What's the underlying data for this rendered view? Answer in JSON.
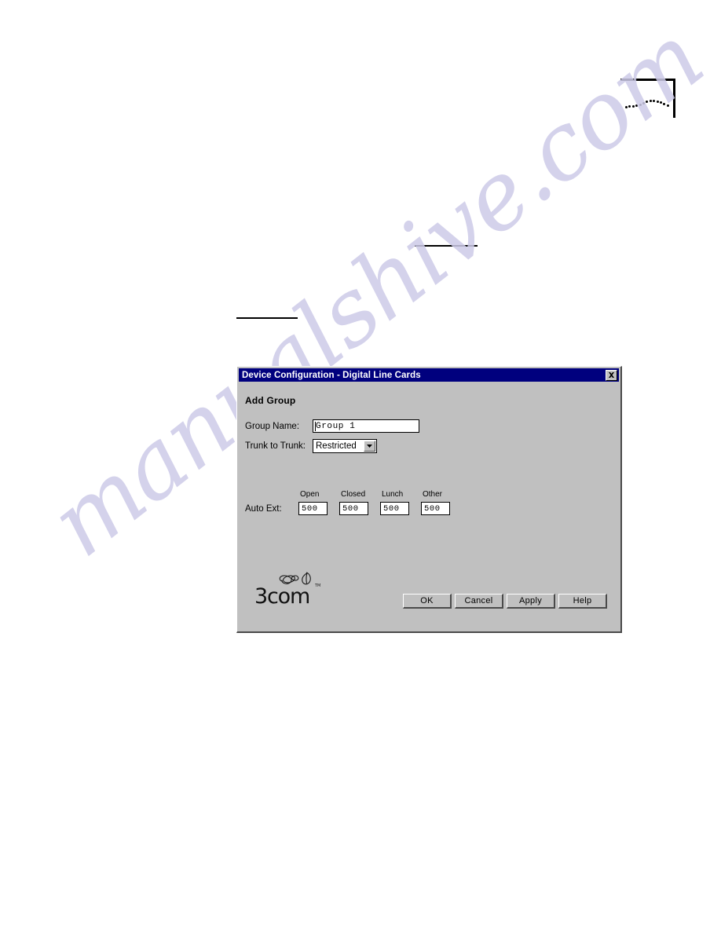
{
  "page": {
    "corner_decoration": {
      "icon": "page-corner-rule",
      "dotted_wave_dots": 13
    },
    "rules": [
      {
        "name": "upper-rule"
      },
      {
        "name": "lower-rule"
      }
    ]
  },
  "watermark": {
    "text": "manualshive.com",
    "color": "#cdcbe8"
  },
  "dialog": {
    "title": "Device Configuration - Digital Line Cards",
    "close_icon": "close-icon",
    "titlebar_color": "#00007e",
    "face_color": "#c0c0c0",
    "heading": "Add Group",
    "fields": {
      "group_name": {
        "label": "Group Name:",
        "value": "Group 1",
        "placeholder": ""
      },
      "trunk_to_trunk": {
        "label": "Trunk to Trunk:",
        "value": "Restricted",
        "arrow_icon": "chevron-down-icon",
        "options": [
          "Restricted"
        ]
      },
      "auto_ext": {
        "label": "Auto Ext:",
        "columns": [
          "Open",
          "Closed",
          "Lunch",
          "Other"
        ],
        "values": [
          "500",
          "500",
          "500",
          "500"
        ]
      }
    },
    "brand": {
      "name": "3com",
      "mark_icon": "3com-swirl-logo-icon"
    },
    "buttons": [
      {
        "label": "OK"
      },
      {
        "label": "Cancel"
      },
      {
        "label": "Apply"
      },
      {
        "label": "Help"
      }
    ]
  }
}
